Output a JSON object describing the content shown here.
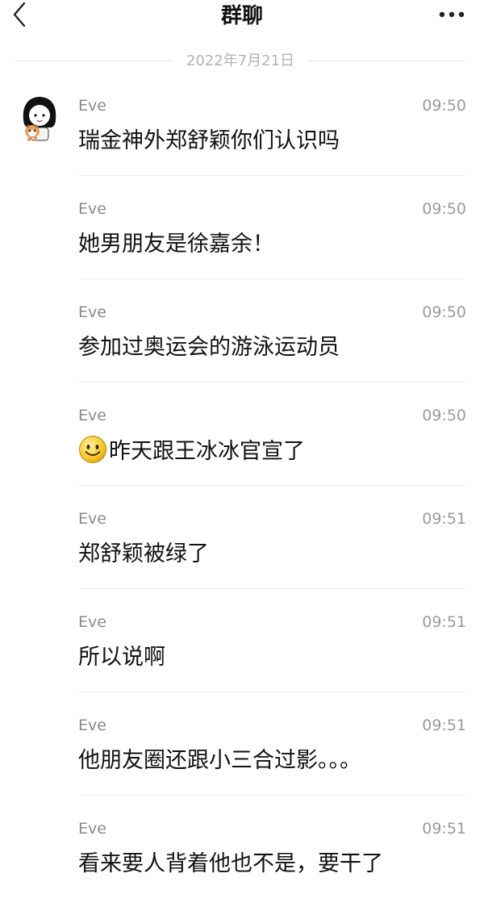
{
  "header": {
    "title": "群聊",
    "back_icon": "chevron-left-icon",
    "more_icon": "more-dots-icon"
  },
  "date_separator": "2022年7月21日",
  "colors": {
    "background": "#ffffff",
    "text": "#111111",
    "meta": "#9a9a9a",
    "divider": "#ececec"
  },
  "messages": [
    {
      "sender": "Eve",
      "time": "09:50",
      "text": "瑞金神外郑舒颖你们认识吗"
    },
    {
      "sender": "Eve",
      "time": "09:50",
      "text": "她男朋友是徐嘉余！"
    },
    {
      "sender": "Eve",
      "time": "09:50",
      "text": "参加过奥运会的游泳运动员"
    },
    {
      "sender": "Eve",
      "time": "09:50",
      "text": "昨天跟王冰冰官宣了",
      "emoji": "smile-emoji"
    },
    {
      "sender": "Eve",
      "time": "09:51",
      "text": "郑舒颖被绿了"
    },
    {
      "sender": "Eve",
      "time": "09:51",
      "text": "所以说啊"
    },
    {
      "sender": "Eve",
      "time": "09:51",
      "text": "他朋友圈还跟小三合过影。。。"
    },
    {
      "sender": "Eve",
      "time": "09:51",
      "text": "看来要人背着他也不是，要干了"
    }
  ]
}
